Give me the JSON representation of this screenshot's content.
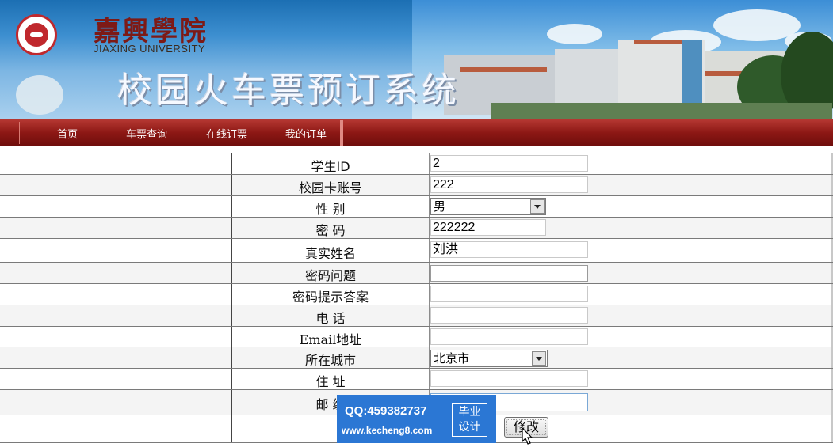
{
  "header": {
    "university_cn": "嘉興學院",
    "university_en": "JIAXING UNIVERSITY",
    "system_title": "校园火车票预订系统"
  },
  "nav": {
    "items": [
      {
        "label": "首页"
      },
      {
        "label": "车票查询"
      },
      {
        "label": "在线订票"
      },
      {
        "label": "我的订单"
      }
    ]
  },
  "form": {
    "fields": [
      {
        "label": "学生ID",
        "value": "2"
      },
      {
        "label": "校园卡账号",
        "value": "222"
      },
      {
        "label": "性 别",
        "value": "男"
      },
      {
        "label": "密 码",
        "value": "222222"
      },
      {
        "label": "真实姓名",
        "value": "刘洪"
      },
      {
        "label": "密码问题",
        "value": ""
      },
      {
        "label": "密码提示答案",
        "value": ""
      },
      {
        "label": "电 话",
        "value": ""
      },
      {
        "label": "Email地址",
        "value": ""
      },
      {
        "label": "所在城市",
        "value": "北京市"
      },
      {
        "label": "住 址",
        "value": ""
      },
      {
        "label": "邮 编",
        "value": ""
      }
    ],
    "submit_label": "修改"
  },
  "watermark": {
    "qq": "QQ:459382737",
    "site": "www.kecheng8.com",
    "tag_line1": "毕业",
    "tag_line2": "设计"
  },
  "colors": {
    "nav_red": "#8d1815",
    "watermark_blue": "#2b77d4",
    "logo_red": "#c0282d"
  }
}
